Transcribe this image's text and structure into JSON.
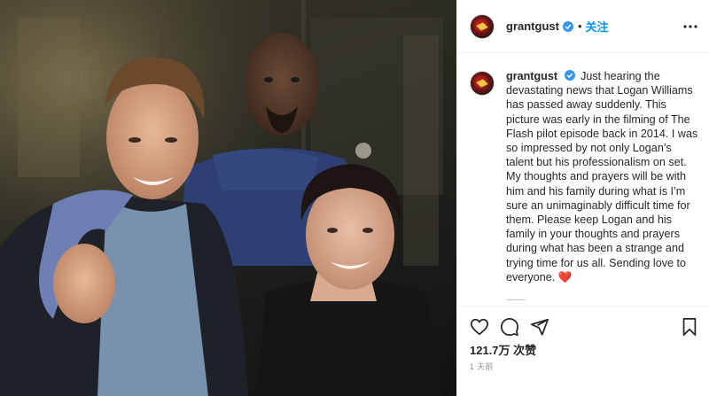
{
  "post": {
    "username": "grantgust",
    "follow_label": "关注",
    "separator": "•",
    "caption_user": "grantgust",
    "caption_body": "Just hearing the devastating news that Logan Williams has passed away suddenly. This picture was early in the filming of The Flash pilot episode back in 2014. I was so impressed by not only Logan’s talent but his professionalism on set. My thoughts and prayers will be with him and his family during what is I’m sure an unimaginably difficult time for them. Please keep Logan and his family in your thoughts and prayers during what has been a strange and trying time for us all. Sending love to everyone.",
    "caption_emoji": "❤️",
    "likes": "121.7万 次赞",
    "timestamp": "1 天前"
  },
  "icons": {
    "verified": "verified-badge-icon",
    "more": "more-options-icon",
    "like": "heart-icon",
    "comment": "comment-icon",
    "share": "share-icon",
    "save": "bookmark-icon"
  },
  "colors": {
    "accent": "#0095f6",
    "text": "#262626",
    "muted": "#8e8e8e",
    "heart": "#ed4956"
  }
}
